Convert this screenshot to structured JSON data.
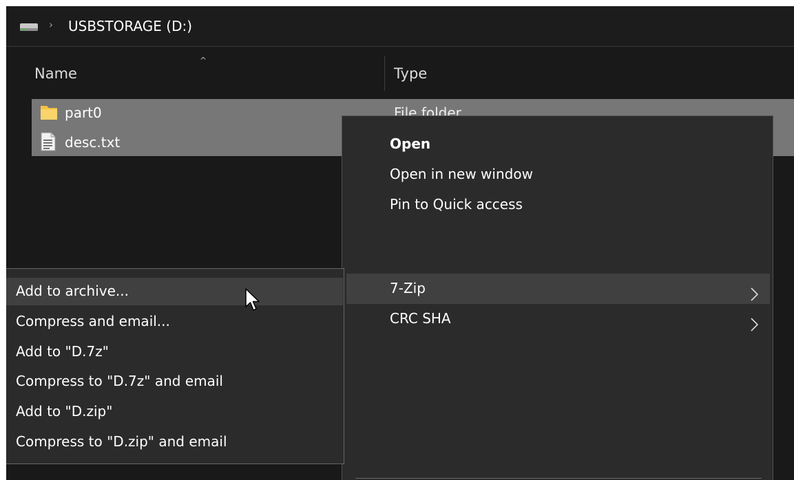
{
  "address_bar": {
    "drive_icon": "drive-icon",
    "chevron": "›",
    "path": "USBSTORAGE (D:)"
  },
  "columns": {
    "sort_indicator": "^",
    "name": "Name",
    "type": "Type"
  },
  "files": [
    {
      "name": "part0",
      "type": "File folder",
      "icon": "folder-icon"
    },
    {
      "name": "desc.txt",
      "icon": "text-file-icon"
    }
  ],
  "context_menu": {
    "items": [
      {
        "label": "Open",
        "bold": true
      },
      {
        "label": "Open in new window"
      },
      {
        "label": "Pin to Quick access"
      },
      {
        "label": "7-Zip",
        "submenu": true,
        "hover": true
      },
      {
        "label": "CRC SHA",
        "submenu": true
      }
    ]
  },
  "submenu_7zip": {
    "items": [
      {
        "label": "Add to archive...",
        "hover": true
      },
      {
        "label": "Compress and email..."
      },
      {
        "label": "Add to \"D.7z\""
      },
      {
        "label": "Compress to \"D.7z\" and email"
      },
      {
        "label": "Add to \"D.zip\""
      },
      {
        "label": "Compress to \"D.zip\" and email"
      }
    ]
  },
  "colors": {
    "window_bg": "#191919",
    "selection": "#777777",
    "menu_bg": "#2b2b2b",
    "menu_hover": "#404040",
    "folder": "#f5c242"
  }
}
